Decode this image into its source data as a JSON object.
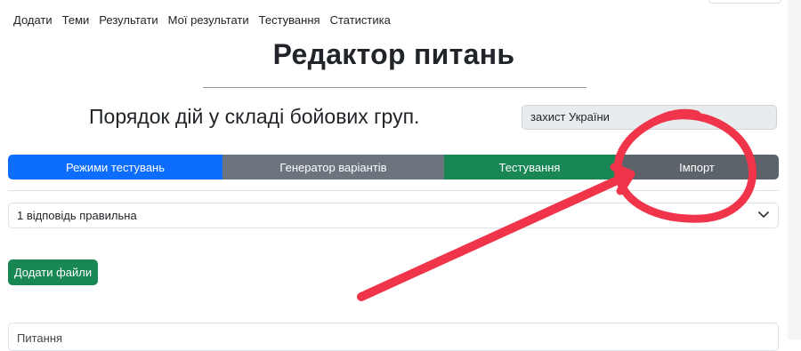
{
  "nav": {
    "items": [
      "Додати",
      "Теми",
      "Результати",
      "Мої результати",
      "Тестування",
      "Статистика"
    ]
  },
  "page": {
    "title": "Редактор питань",
    "section_heading": "Порядок дій у складі бойових груп."
  },
  "topic_field": {
    "value": "захист України"
  },
  "mode_buttons": [
    "Режими тестувань",
    "Генератор варіантів",
    "Тестування",
    "Імпорт"
  ],
  "answer_mode_select": {
    "selected": "1 відповідь правильна"
  },
  "add_files_button": "Додати файли",
  "question_field": {
    "label": "Питання"
  },
  "annotation": {
    "color": "#f0344a",
    "shapes": [
      "circle-around-import",
      "arrow-to-import"
    ]
  },
  "colors": {
    "primary": "#0d6efd",
    "secondary": "#6c757d",
    "success": "#198754",
    "dark_secondary": "#5c636a"
  }
}
